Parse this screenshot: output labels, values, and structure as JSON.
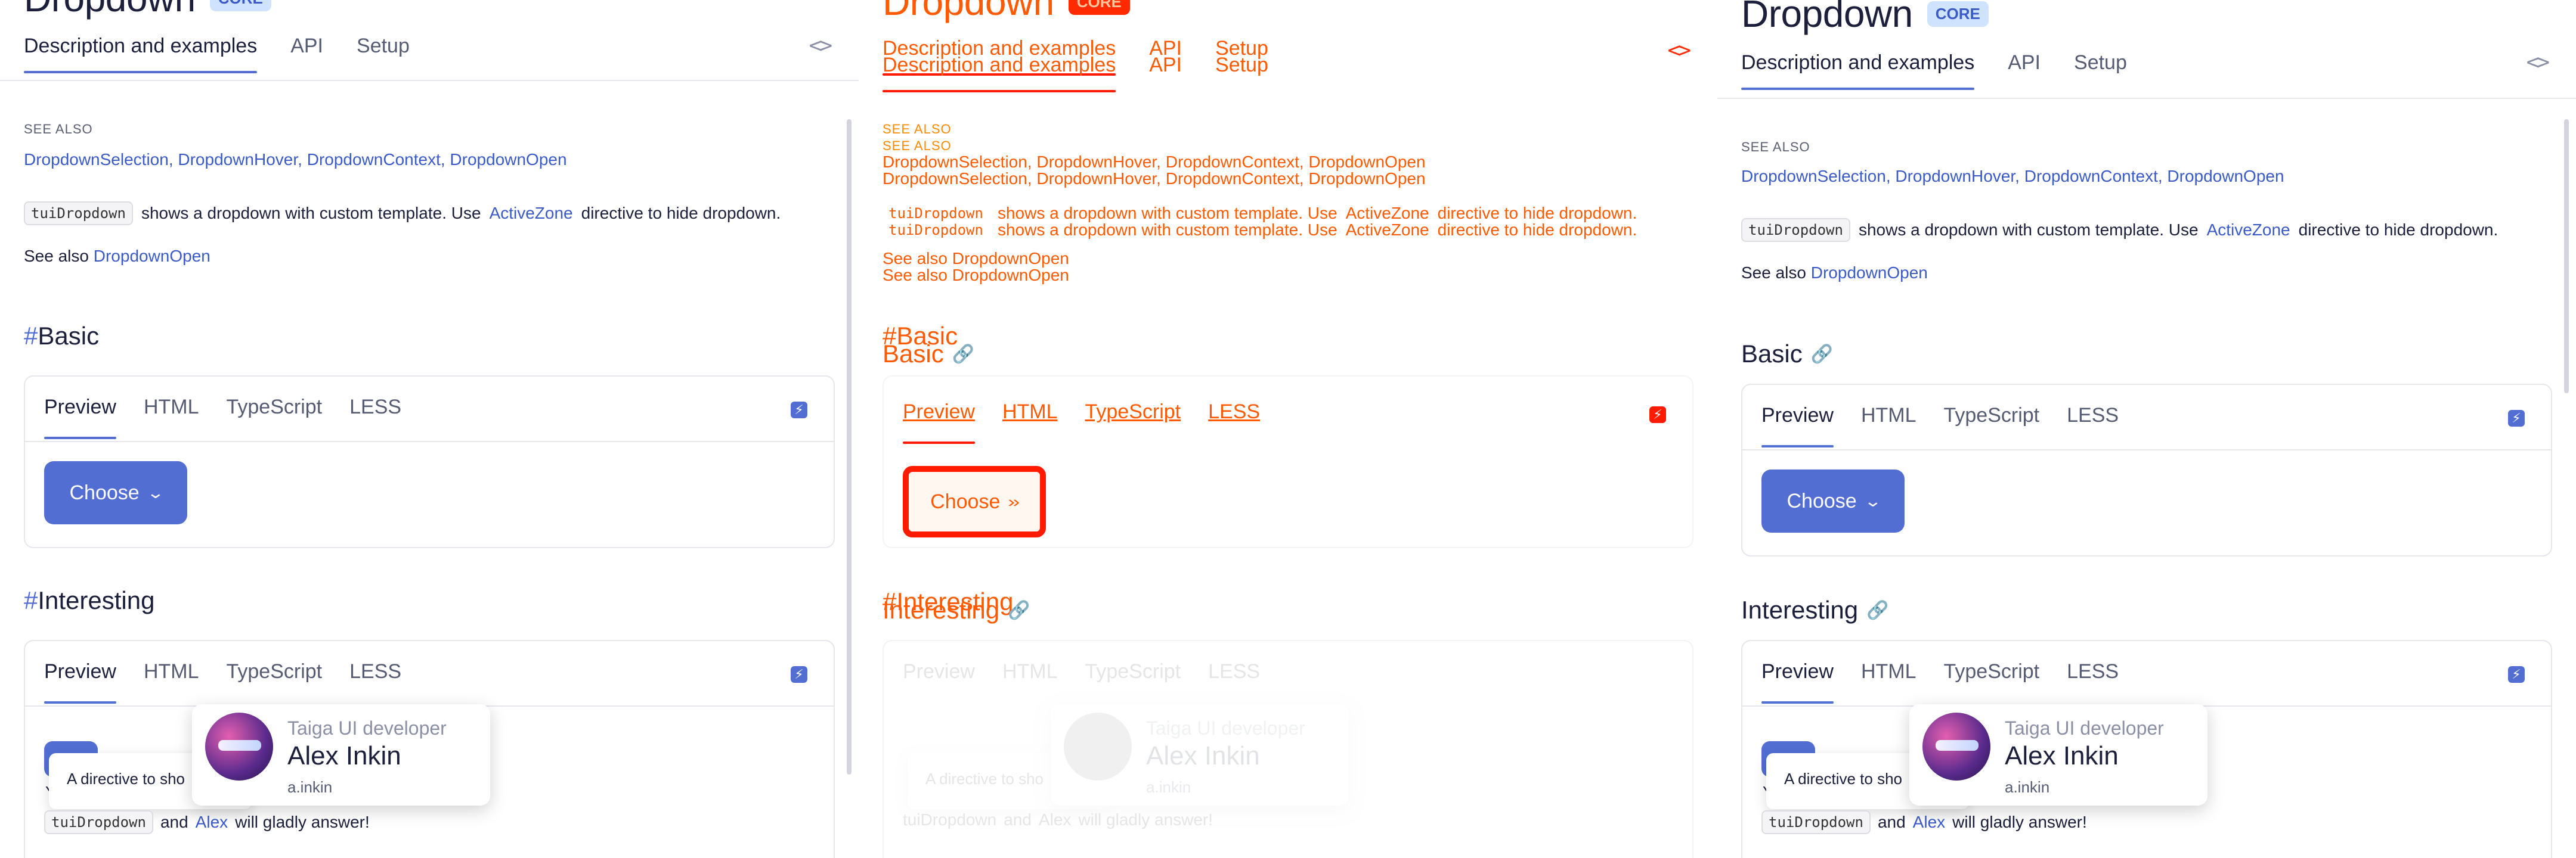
{
  "page": {
    "title": "Dropdown",
    "badge": "CORE",
    "tabs": [
      "Description and examples",
      "API",
      "Setup"
    ],
    "code_toggle": "<>",
    "see_also_label": "SEE ALSO",
    "see_also_links": [
      "DropdownSelection",
      "DropdownHover",
      "DropdownContext",
      "DropdownOpen"
    ],
    "description": {
      "chip": "tuiDropdown",
      "text_before": "shows a dropdown with custom template. Use",
      "link": "ActiveZone",
      "text_after": "directive to hide dropdown."
    },
    "see_also_line": {
      "prefix": "See also",
      "link": "DropdownOpen"
    }
  },
  "sections": {
    "basic": {
      "hash": "#",
      "heading": "Basic",
      "tabs": [
        "Preview",
        "HTML",
        "TypeScript",
        "LESS"
      ],
      "button_label": "Choose"
    },
    "interesting": {
      "hash": "#",
      "heading": "Interesting",
      "tabs": [
        "Preview",
        "HTML",
        "TypeScript",
        "LESS"
      ],
      "tooltip_text": "A directive to sho",
      "y_letter": "Y",
      "bottom": {
        "chip": "tuiDropdown",
        "text_and": "and",
        "link": "Alex",
        "text_after": "will gladly answer!"
      },
      "profile": {
        "role": "Taiga UI developer",
        "name": "Alex Inkin",
        "handle": "a.inkin"
      }
    }
  },
  "colors": {
    "accent": "#526ed3",
    "link": "#3a5ac8",
    "diff": "#ff5a00",
    "diff_strong": "#ff1a00"
  },
  "icons": {
    "code_toggle": "code-icon",
    "link": "link-icon",
    "bolt": "bolt-icon",
    "chevron": "chevron-down-icon"
  }
}
